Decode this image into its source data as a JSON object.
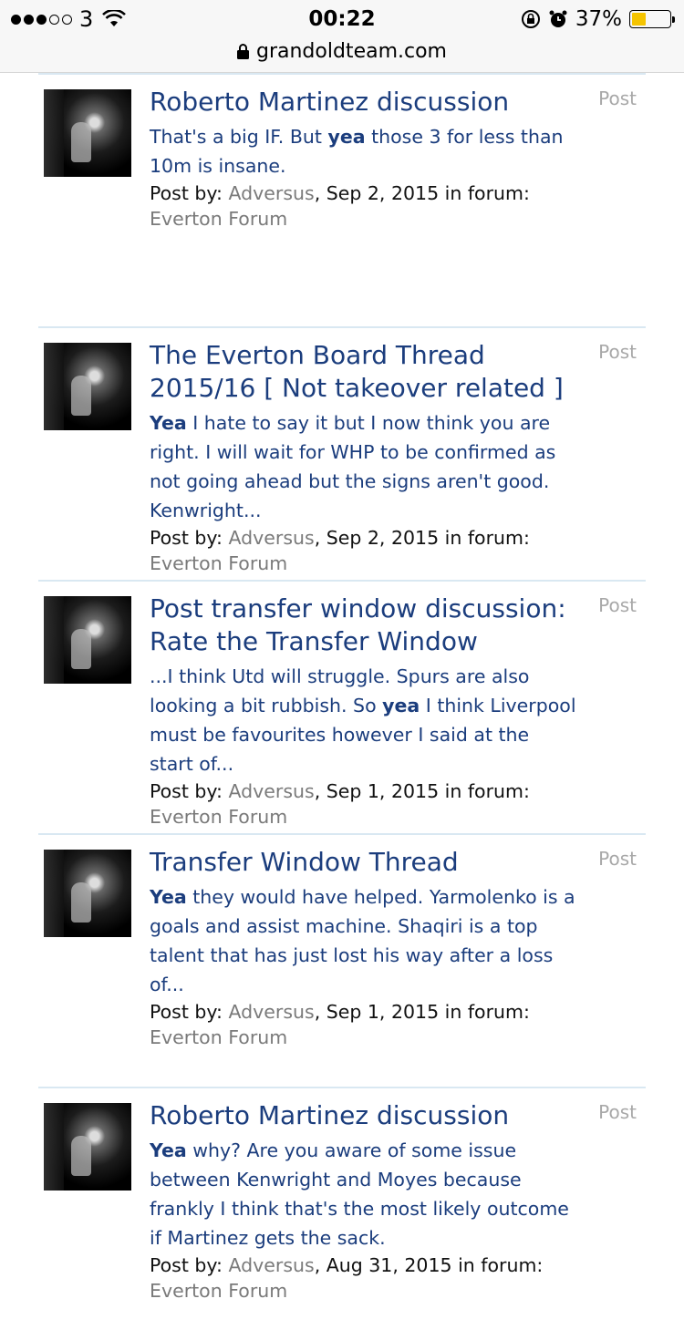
{
  "status_bar": {
    "carrier": "3",
    "time": "00:22",
    "battery_percent": "37%",
    "battery_level": 0.37,
    "url": "grandoldteam.com"
  },
  "results": [
    {
      "title": "Roberto Martinez discussion",
      "content_type": "Post",
      "snippet_before": "That's a big IF. But ",
      "snippet_highlight": "yea",
      "snippet_after": " those 3 for less than 10m is insane.",
      "meta_prefix": "Post by: ",
      "author": "Adversus",
      "date_text": ", Sep 2, 2015 in forum: ",
      "forum": "Everton Forum"
    },
    {
      "title": "The Everton Board Thread 2015/16 [ Not takeover related ]",
      "content_type": "Post",
      "snippet_before": "",
      "snippet_highlight": "Yea",
      "snippet_after": " I hate to say it but I now think you are right. I will wait for WHP to be confirmed as not going ahead but the signs aren't good. Kenwright...",
      "meta_prefix": "Post by: ",
      "author": "Adversus",
      "date_text": ", Sep 2, 2015 in forum: ",
      "forum": "Everton Forum"
    },
    {
      "title": "Post transfer window discussion: Rate the Transfer Window",
      "content_type": "Post",
      "snippet_before": "...I think Utd will struggle. Spurs are also looking a bit rubbish. So ",
      "snippet_highlight": "yea",
      "snippet_after": " I think Liverpool must be favourites however I said at the start of...",
      "meta_prefix": "Post by: ",
      "author": "Adversus",
      "date_text": ", Sep 1, 2015 in forum: ",
      "forum": "Everton Forum"
    },
    {
      "title": "Transfer Window Thread",
      "content_type": "Post",
      "snippet_before": "",
      "snippet_highlight": "Yea",
      "snippet_after": " they would have helped. Yarmolenko is a goals and assist machine. Shaqiri is a top talent that has just lost his way after a loss of...",
      "meta_prefix": "Post by: ",
      "author": "Adversus",
      "date_text": ", Sep 1, 2015 in forum: ",
      "forum": "Everton Forum"
    },
    {
      "title": "Roberto Martinez discussion",
      "content_type": "Post",
      "snippet_before": "",
      "snippet_highlight": "Yea",
      "snippet_after": " why? Are you aware of some issue between Kenwright and Moyes because frankly I think that's the most likely outcome if Martinez gets the sack.",
      "meta_prefix": "Post by: ",
      "author": "Adversus",
      "date_text": ", Aug 31, 2015 in forum: ",
      "forum": "Everton Forum"
    }
  ]
}
